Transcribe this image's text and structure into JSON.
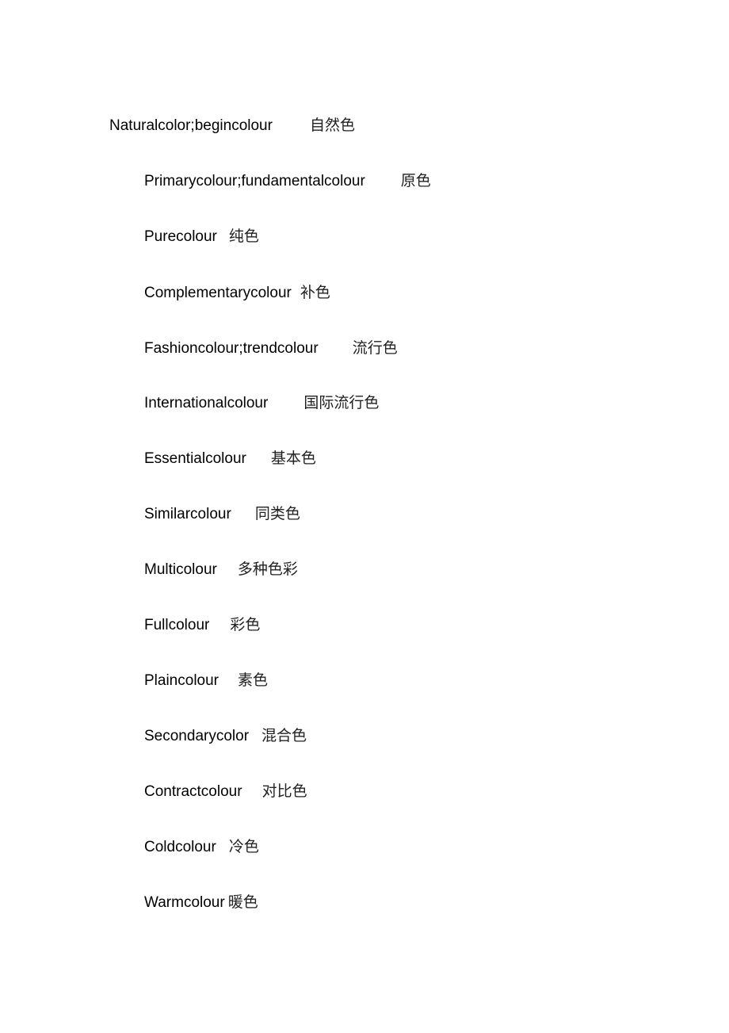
{
  "entries": [
    {
      "en": "Naturalcolor;begincolour",
      "zh": "自然色"
    },
    {
      "en": "Primarycolour;fundamentalcolour",
      "zh": "原色"
    },
    {
      "en": "Purecolour",
      "zh": "纯色"
    },
    {
      "en": "Complementarycolour",
      "zh": "补色"
    },
    {
      "en": "Fashioncolour;trendcolour",
      "zh": "流行色"
    },
    {
      "en": "Internationalcolour",
      "zh": "国际流行色"
    },
    {
      "en": "Essentialcolour",
      "zh": "基本色"
    },
    {
      "en": "Similarcolour",
      "zh": "同类色"
    },
    {
      "en": "Multicolour",
      "zh": "多种色彩"
    },
    {
      "en": "Fullcolour",
      "zh": "彩色"
    },
    {
      "en": "Plaincolour",
      "zh": "素色"
    },
    {
      "en": "Secondarycolor",
      "zh": "混合色"
    },
    {
      "en": "Contractcolour",
      "zh": "对比色"
    },
    {
      "en": "Coldcolour",
      "zh": "冷色"
    },
    {
      "en": "Warmcolour",
      "zh": "暖色"
    }
  ]
}
